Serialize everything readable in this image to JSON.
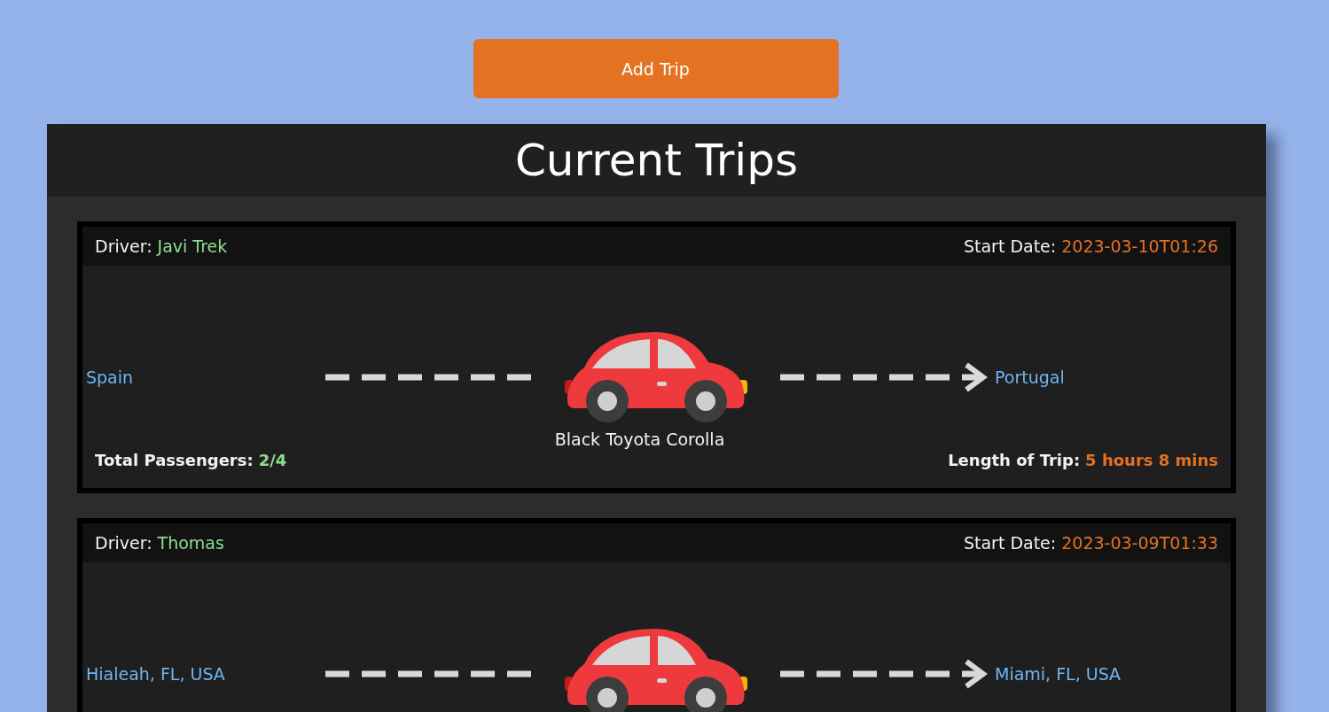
{
  "add_button": {
    "label": "Add Trip"
  },
  "panel": {
    "title": "Current Trips"
  },
  "trips": [
    {
      "driver": {
        "label": "Driver:",
        "value": "Javi Trek"
      },
      "start_date": {
        "label": "Start Date:",
        "value": "2023-03-10T01:26"
      },
      "origin": "Spain",
      "destination": "Portugal",
      "vehicle": "Black Toyota Corolla",
      "passengers": {
        "label": "Total Passengers:",
        "value": "2/4"
      },
      "length": {
        "label": "Length of Trip:",
        "value": "5 hours 8 mins"
      }
    },
    {
      "driver": {
        "label": "Driver:",
        "value": "Thomas"
      },
      "start_date": {
        "label": "Start Date:",
        "value": "2023-03-09T01:33"
      },
      "origin": "Hialeah, FL, USA",
      "destination": "Miami, FL, USA"
    }
  ]
}
